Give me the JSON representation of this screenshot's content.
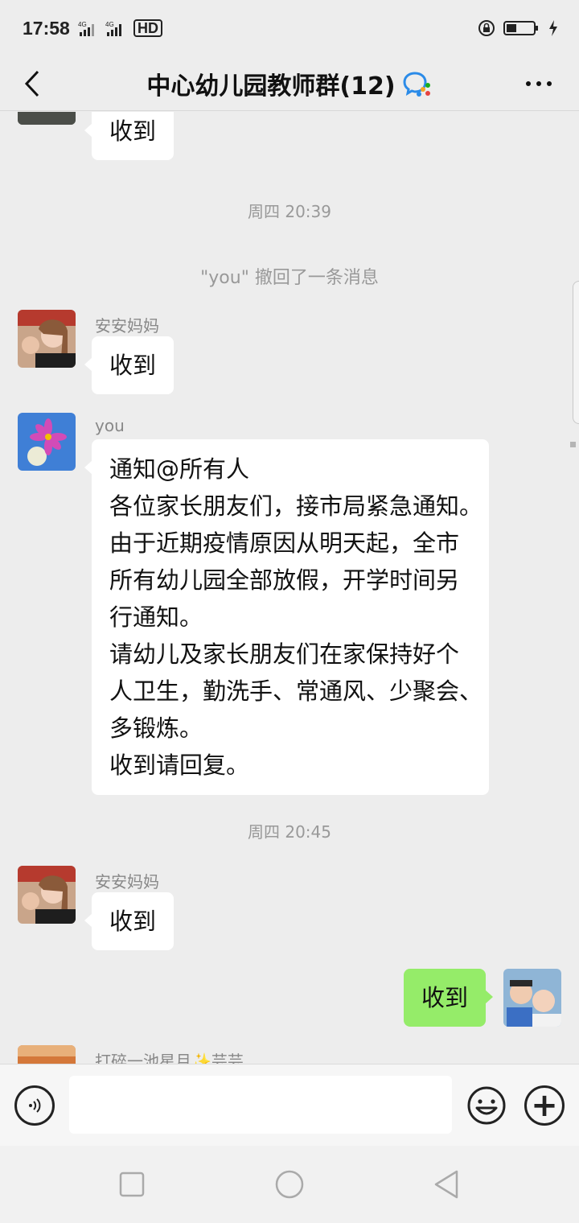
{
  "status_bar": {
    "time": "17:58",
    "signal_1": "4G",
    "signal_2": "4G",
    "hd": "HD",
    "icons": [
      "signal-icon",
      "signal-icon",
      "hd-icon",
      "lock-rotation-icon",
      "battery-icon",
      "charging-icon"
    ]
  },
  "nav": {
    "title": "中心幼儿园教师群(12)",
    "back_icon": "chevron-left-icon",
    "chat_badge_icon": "enterprise-chat-icon",
    "more_icon": "more-dots-icon"
  },
  "messages": {
    "m0": {
      "text": "收到"
    },
    "t1": {
      "text": "周四 20:39"
    },
    "s1": {
      "text": "\"you\" 撤回了一条消息"
    },
    "m1": {
      "sender": "安安妈妈",
      "text": "收到"
    },
    "m2": {
      "sender": "you",
      "lines": [
        "通知@所有人",
        "各位家长朋友们，接市局紧急通知。",
        "由于近期疫情原因从明天起，全市",
        "所有幼儿园全部放假，开学时间另",
        "行通知。",
        "请幼儿及家长朋友们在家保持好个",
        "人卫生，勤洗手、常通风、少聚会、",
        "多锻炼。",
        "收到请回复。"
      ]
    },
    "t2": {
      "text": "周四 20:45"
    },
    "m3": {
      "sender": "安安妈妈",
      "text": "收到"
    },
    "m4": {
      "text": "收到"
    },
    "m5": {
      "sender": "打碎一池星月✨芸芸"
    }
  },
  "input_bar": {
    "voice_icon": "voice-icon",
    "placeholder": "",
    "emoji_icon": "emoji-icon",
    "plus_icon": "plus-icon",
    "plus_label": "+"
  },
  "system_nav": {
    "icons": [
      "recent-apps-icon",
      "home-icon",
      "back-icon"
    ]
  },
  "colors": {
    "background": "#ededed",
    "my_bubble": "#95ec69",
    "other_bubble": "#ffffff",
    "meta_text": "#999999"
  }
}
